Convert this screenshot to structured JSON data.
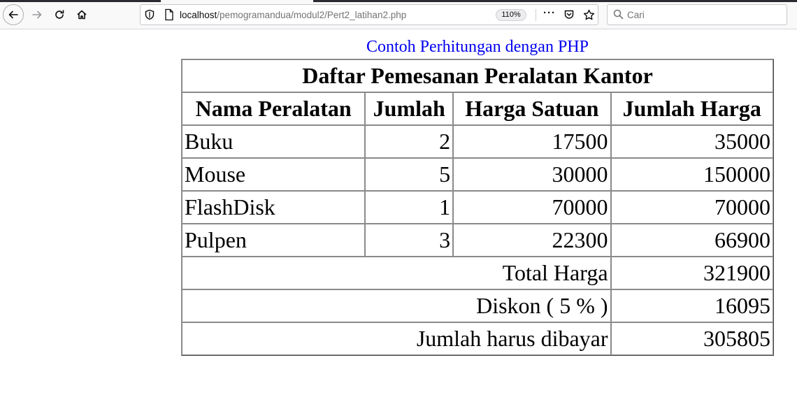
{
  "browser": {
    "url_host": "localhost",
    "url_path": "/pemogramandua/modul2/Pert2_latihan2.php",
    "zoom": "110%",
    "search_placeholder": "Cari",
    "icons": [
      "back-icon",
      "forward-icon",
      "reload-icon",
      "home-icon",
      "shield-icon",
      "page-icon",
      "meatball-menu-icon",
      "pocket-icon",
      "bookmark-star-icon",
      "search-icon"
    ]
  },
  "page": {
    "caption": "Contoh Perhitungan dengan PHP",
    "table": {
      "title": "Daftar Pemesanan Peralatan Kantor",
      "headers": [
        "Nama Peralatan",
        "Jumlah",
        "Harga Satuan",
        "Jumlah Harga"
      ],
      "rows": [
        {
          "name": "Buku",
          "qty": "2",
          "price": "17500",
          "total": "35000"
        },
        {
          "name": "Mouse",
          "qty": "5",
          "price": "30000",
          "total": "150000"
        },
        {
          "name": "FlashDisk",
          "qty": "1",
          "price": "70000",
          "total": "70000"
        },
        {
          "name": "Pulpen",
          "qty": "3",
          "price": "22300",
          "total": "66900"
        }
      ],
      "summary": [
        {
          "label": "Total Harga",
          "value": "321900"
        },
        {
          "label": "Diskon ( 5 % )",
          "value": "16095"
        },
        {
          "label": "Jumlah harus dibayar",
          "value": "305805"
        }
      ]
    }
  },
  "colors": {
    "caption": "#0000ee",
    "table_border": "#8a8a8a",
    "toolbar_bg": "#f9f9fa"
  }
}
